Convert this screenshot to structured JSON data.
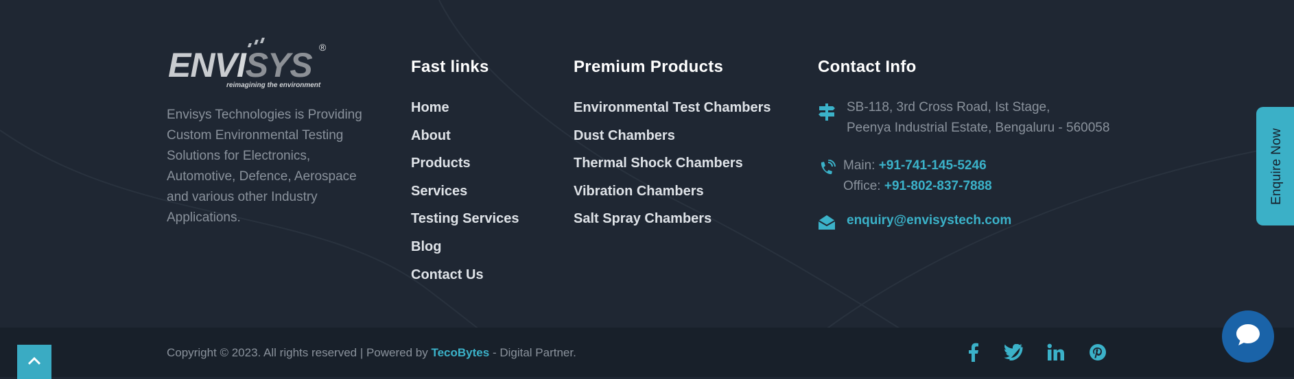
{
  "brand": {
    "logo_text_light": "ENV",
    "logo_text_mid": "I",
    "logo_text_dark": "SYS",
    "registered": "®",
    "tagline": "reimagining the environment",
    "description": "Envisys Technologies is Providing Custom Environmental Testing Solutions for Electronics, Automotive, Defence, Aerospace and various other Industry Applications."
  },
  "fast_links": {
    "title": "Fast links",
    "items": [
      "Home",
      "About",
      "Products",
      "Services",
      "Testing Services",
      "Blog",
      "Contact Us"
    ]
  },
  "premium_products": {
    "title": "Premium Products",
    "items": [
      "Environmental Test Chambers",
      "Dust Chambers",
      "Thermal Shock Chambers",
      "Vibration Chambers",
      "Salt Spray Chambers"
    ]
  },
  "contact": {
    "title": "Contact Info",
    "address_line1": "SB-118, 3rd Cross Road, Ist Stage,",
    "address_line2": "Peenya Industrial Estate, Bengaluru - 560058",
    "main_label": "Main:",
    "main_phone": "+91-741-145-5246",
    "office_label": "Office:",
    "office_phone": "+91-802-837-7888",
    "email": "enquiry@envisystech.com"
  },
  "enquire_tab": "Enquire Now",
  "footer_bottom": {
    "copyright_prefix": "Copyright © 2023. All rights reserved | Powered by",
    "partner_name": "TecoBytes",
    "copyright_suffix": "- Digital Partner."
  },
  "icons": {
    "address": "signpost-icon",
    "phone": "phone-volume-icon",
    "email": "envelope-open-icon",
    "scroll_top": "chevron-up-icon",
    "facebook": "facebook-icon",
    "twitter": "twitter-icon",
    "linkedin": "linkedin-icon",
    "pinterest": "pinterest-icon",
    "chat": "chat-bubble-icon"
  },
  "colors": {
    "background": "#1f2733",
    "bottom_bar": "#18202a",
    "accent": "#3bb2c9",
    "chat": "#1a63a8"
  }
}
